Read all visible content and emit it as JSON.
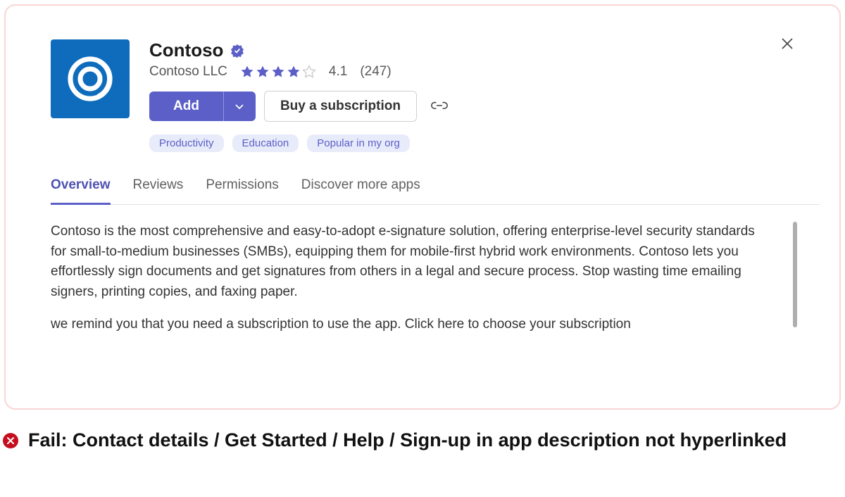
{
  "app": {
    "name": "Contoso",
    "publisher": "Contoso LLC",
    "rating": "4.1",
    "rating_count": "(247)",
    "stars_filled": 4,
    "stars_total": 5
  },
  "actions": {
    "add": "Add",
    "buy": "Buy a subscription"
  },
  "tags": [
    "Productivity",
    "Education",
    "Popular in my org"
  ],
  "tabs": [
    {
      "label": "Overview",
      "active": true
    },
    {
      "label": "Reviews",
      "active": false
    },
    {
      "label": "Permissions",
      "active": false
    },
    {
      "label": "Discover more apps",
      "active": false
    }
  ],
  "overview": {
    "p1": "Contoso is the most comprehensive and easy-to-adopt e-signature solution, offering enterprise-level security standards for small-to-medium businesses (SMBs), equipping them for mobile-first hybrid work environments. Contoso lets you effortlessly sign documents and get signatures from others in a legal and secure process. Stop wasting time emailing signers, printing copies, and faxing paper.",
    "p2": "we remind you that  you need a subscription to use the app. Click here to choose your subscription"
  },
  "annotation": {
    "fail_text": "Fail: Contact details / Get Started / Help / Sign-up in app description not hyperlinked"
  },
  "colors": {
    "accent": "#5b5fc7",
    "brand_icon": "#0f6cbd",
    "error": "#c50f1f",
    "card_border": "#f9d6d6"
  }
}
